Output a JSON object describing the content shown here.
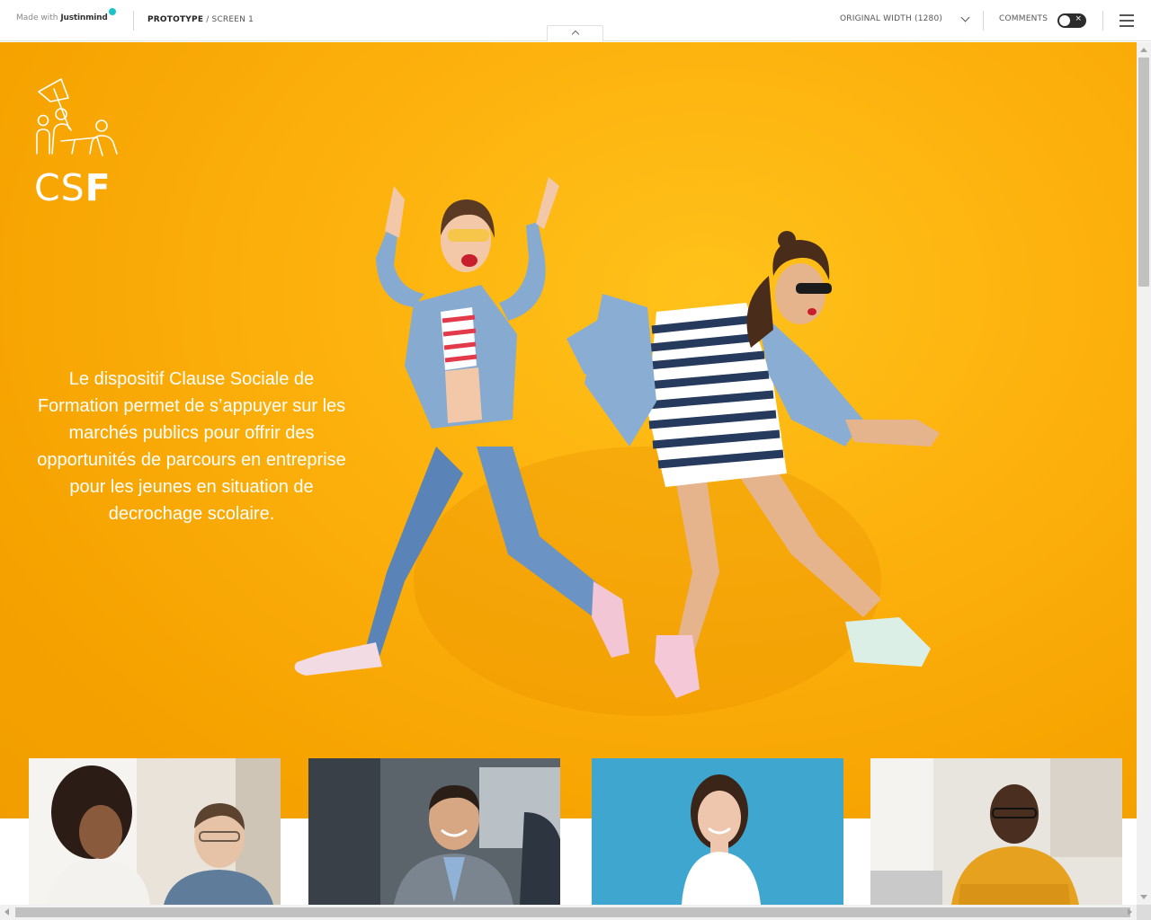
{
  "toolbar": {
    "made_with": "Made with",
    "brand": "Justinmind",
    "breadcrumb": {
      "prototype": "PROTOTYPE",
      "separator": " / ",
      "screen": "SCREEN 1"
    },
    "width_label": "ORIGINAL WIDTH (1280)",
    "comments_label": "COMMENTS",
    "comments_toggle": {
      "state": "off",
      "close_glyph": "×"
    },
    "menu_icon": "hamburger-icon",
    "collapse_icon": "chevron-up-icon"
  },
  "hero": {
    "background": "#fdb10d",
    "logo": {
      "prefix": "CS",
      "bold": "F",
      "icon": "people-with-flag-icon"
    },
    "text": "Le dispositif Clause Sociale de Formation permet de s’appuyer sur les marchés publics pour offrir des opportunités de parcours en entreprise pour les jeunes en situation de decrochage scolaire.",
    "image": "two-jumping-young-women-photo"
  },
  "cards": [
    {
      "image": "two-people-meeting-photo"
    },
    {
      "image": "smiling-man-in-suit-photo"
    },
    {
      "image": "smiling-woman-blue-background-photo"
    },
    {
      "image": "man-yellow-sweater-photo"
    }
  ],
  "colors": {
    "accent": "#1bc4c9",
    "hero": "#fdb10d",
    "toolbar_text": "#555555"
  }
}
